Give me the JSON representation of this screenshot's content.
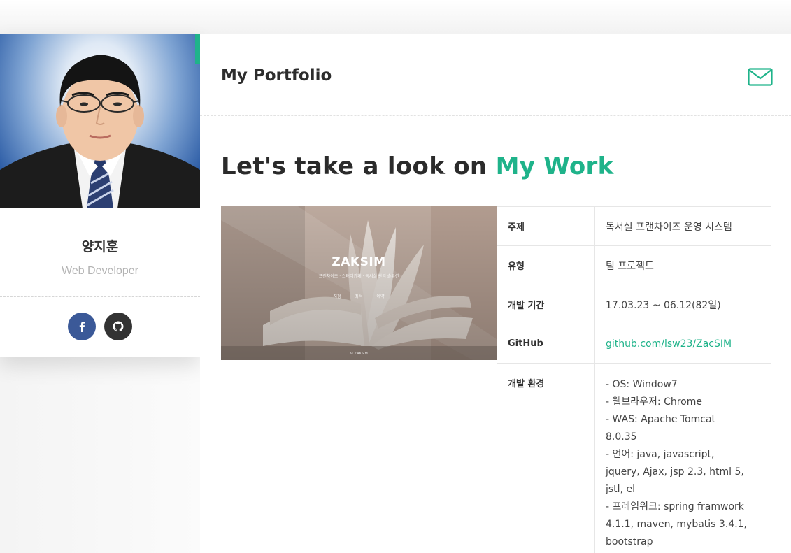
{
  "profile": {
    "name": "양지훈",
    "role": "Web Developer",
    "social": [
      {
        "icon": "facebook-icon",
        "color": "#3b5998"
      },
      {
        "icon": "github-icon",
        "color": "#333333"
      }
    ]
  },
  "header": {
    "title": "My Portfolio",
    "mail_icon": "mail-icon"
  },
  "heading": {
    "prefix": "Let's take a look on ",
    "accent": "My Work"
  },
  "project_image": {
    "logo": "ZAKSIM",
    "subtitle": "프랜차이즈 · 스터디카페 · 독서실 관리 솔루션",
    "nav": [
      "지점",
      "좌석",
      "예약"
    ],
    "footer": "© ZAKSIM"
  },
  "info": {
    "rows": [
      {
        "label": "주제",
        "value": "독서실 프랜차이즈 운영 시스템"
      },
      {
        "label": "유형",
        "value": "팀 프로젝트"
      },
      {
        "label": "개발 기간",
        "value": "17.03.23 ~ 06.12(82일)"
      },
      {
        "label": "GitHub",
        "value": "github.com/lsw23/ZacSIM"
      }
    ],
    "env_label": "개발 환경",
    "env_lines": [
      "- OS: Window7",
      "- 웹브라우저: Chrome",
      "- WAS: Apache Tomcat",
      "8.0.35",
      "- 언어: java, javascript,",
      "jquery, Ajax, jsp 2.3, html 5,",
      "jstl, el",
      "- 프레임워크: spring framwork",
      "4.1.1, maven, mybatis 3.4.1,",
      "bootstrap"
    ]
  },
  "colors": {
    "accent": "#1fb38a",
    "facebook": "#3b5998",
    "github": "#333333"
  }
}
